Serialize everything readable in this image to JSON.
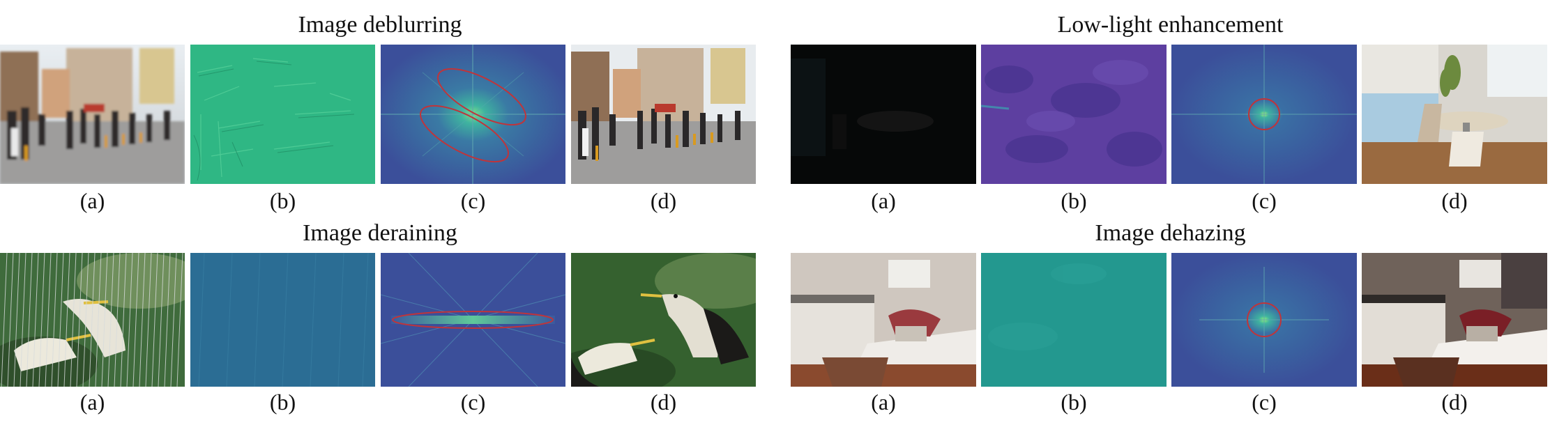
{
  "figure": {
    "groups": [
      {
        "id": "deblur",
        "title": "Image deblurring",
        "captions": [
          "(a)",
          "(b)",
          "(c)",
          "(d)"
        ]
      },
      {
        "id": "lowlight",
        "title": "Low-light enhancement",
        "captions": [
          "(a)",
          "(b)",
          "(c)",
          "(d)"
        ]
      },
      {
        "id": "derain",
        "title": "Image deraining",
        "captions": [
          "(a)",
          "(b)",
          "(c)",
          "(d)"
        ]
      },
      {
        "id": "dehaze",
        "title": "Image dehazing",
        "captions": [
          "(a)",
          "(b)",
          "(c)",
          "(d)"
        ]
      }
    ]
  },
  "colors": {
    "spectrum_bg": "#3b4f9a",
    "spectrum_center": "#6fe27a",
    "highlight_ring": "#c0343a",
    "residual_green": "#2fb784",
    "residual_blue": "#2b6d94",
    "residual_purple": "#5d3fa0",
    "residual_teal": "#23988f"
  }
}
